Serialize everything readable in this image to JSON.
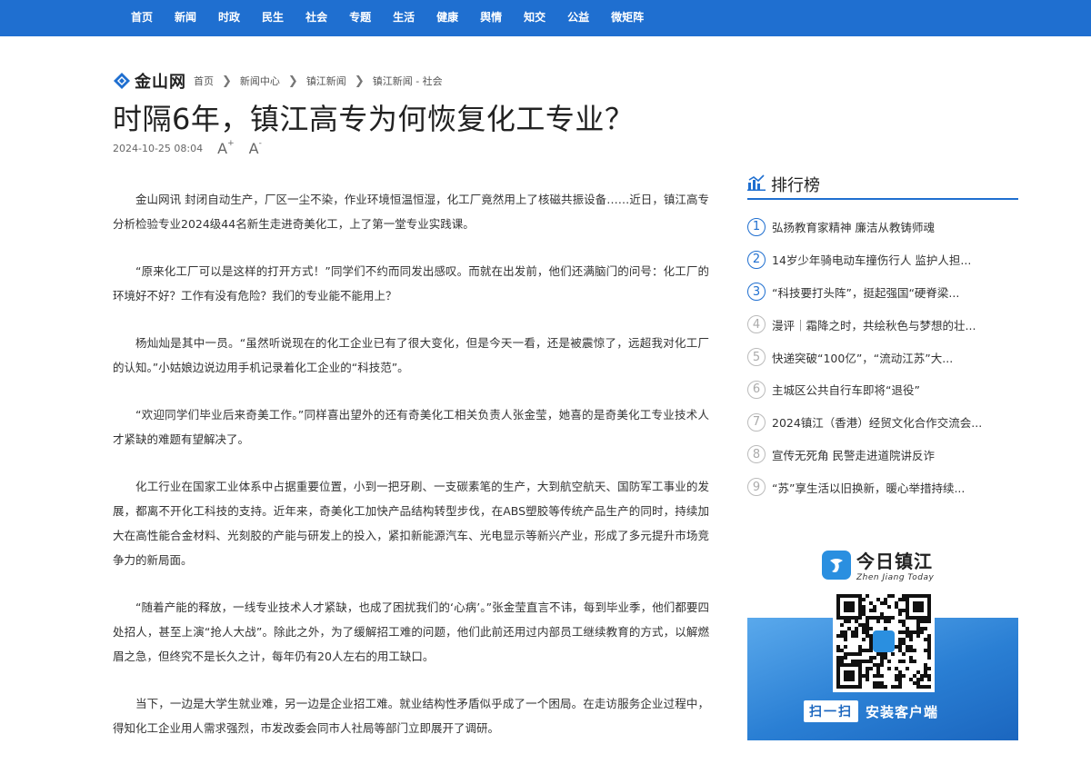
{
  "nav": {
    "items": [
      "首页",
      "新闻",
      "时政",
      "民生",
      "社会",
      "专题",
      "生活",
      "健康",
      "舆情",
      "知交",
      "公益",
      "微矩阵"
    ]
  },
  "logo": {
    "text": "金山网"
  },
  "breadcrumb": {
    "items": [
      "首页",
      "新闻中心",
      "镇江新闻",
      "镇江新闻 - 社会"
    ]
  },
  "article": {
    "title": "时隔6年，镇江高专为何恢复化工专业？",
    "datetime": "2024-10-25 08:04",
    "font_increase": "A",
    "font_decrease": "A",
    "font_increase_sign": "+",
    "font_decrease_sign": "-",
    "paragraphs": [
      "金山网讯 封闭自动生产，厂区一尘不染，作业环境恒温恒湿，化工厂竟然用上了核磁共振设备……近日，镇江高专分析检验专业2024级44名新生走进奇美化工，上了第一堂专业实践课。",
      "“原来化工厂可以是这样的打开方式！”同学们不约而同发出感叹。而就在出发前，他们还满脑门的问号：化工厂的环境好不好？工作有没有危险？我们的专业能不能用上？",
      "杨灿灿是其中一员。“虽然听说现在的化工企业已有了很大变化，但是今天一看，还是被震惊了，远超我对化工厂的认知。”小姑娘边说边用手机记录着化工企业的“科技范”。",
      "“欢迎同学们毕业后来奇美工作。”同样喜出望外的还有奇美化工相关负责人张金莹，她喜的是奇美化工专业技术人才紧缺的难题有望解决了。",
      "化工行业在国家工业体系中占据重要位置，小到一把牙刷、一支碳素笔的生产，大到航空航天、国防军工事业的发展，都离不开化工科技的支持。近年来，奇美化工加快产品结构转型步伐，在ABS塑胶等传统产品生产的同时，持续加大在高性能合金材料、光刻胶的产能与研发上的投入，紧扣新能源汽车、光电显示等新兴产业，形成了多元提升市场竞争力的新局面。",
      "“随着产能的释放，一线专业技术人才紧缺，也成了困扰我们的‘心病’。”张金莹直言不讳，每到毕业季，他们都要四处招人，甚至上演“抢人大战”。除此之外，为了缓解招工难的问题，他们此前还用过内部员工继续教育的方式，以解燃眉之急，但终究不是长久之计，每年仍有20人左右的用工缺口。",
      "当下，一边是大学生就业难，另一边是企业招工难。就业结构性矛盾似乎成了一个困局。在走访服务企业过程中，得知化工企业用人需求强烈，市发改委会同市人社局等部门立即展开了调研。"
    ]
  },
  "ranking": {
    "title": "排行榜",
    "items": [
      {
        "num": "1",
        "text": "弘扬教育家精神 廉洁从教铸师魂"
      },
      {
        "num": "2",
        "text": "14岁少年骑电动车撞伤行人 监护人担..."
      },
      {
        "num": "3",
        "text": "“科技要打头阵”，挺起强国“硬脊梁..."
      },
      {
        "num": "4",
        "text": "漫评｜霜降之时，共绘秋色与梦想的壮..."
      },
      {
        "num": "5",
        "text": "快递突破“100亿”，“流动江苏”大..."
      },
      {
        "num": "6",
        "text": "主城区公共自行车即将“退役”"
      },
      {
        "num": "7",
        "text": "2024镇江（香港）经贸文化合作交流会..."
      },
      {
        "num": "8",
        "text": "宣传无死角 民警走进道院讲反诈"
      },
      {
        "num": "9",
        "text": "“苏”享生活以旧换新，暖心举措持续..."
      }
    ]
  },
  "app_ad": {
    "name_cn": "今日镇江",
    "name_en": "Zhen Jiang Today",
    "cta_box": "扫一扫",
    "cta_text": "安装客户端"
  },
  "colors": {
    "nav_bg": "#1f6fd0",
    "rank_top": "#1f6fd0",
    "rank_other": "#aaaaaa",
    "ad_blue": "#2a7fd4"
  }
}
